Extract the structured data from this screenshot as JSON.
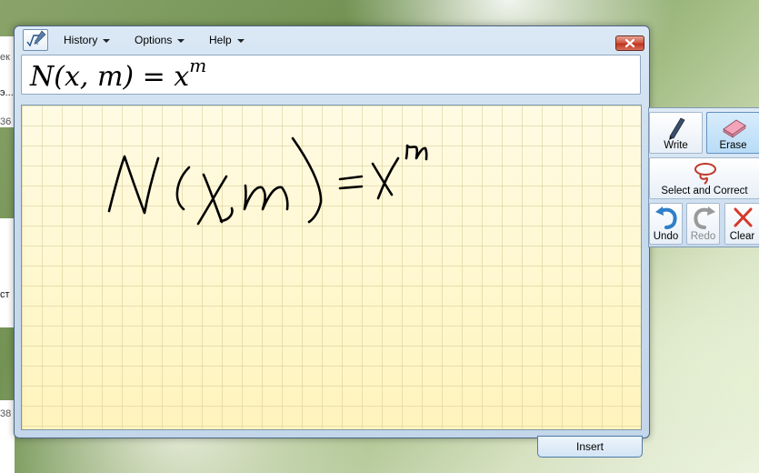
{
  "background": {
    "fragments": [
      "ек",
      "э...",
      "36",
      "ст",
      "38"
    ]
  },
  "window": {
    "menu": [
      {
        "label": "History"
      },
      {
        "label": "Options"
      },
      {
        "label": "Help"
      }
    ],
    "preview_formula": "N(x, m) = x",
    "preview_superscript": "m",
    "insert_label": "Insert"
  },
  "tools": {
    "write": "Write",
    "erase": "Erase",
    "select_correct": "Select and Correct",
    "undo": "Undo",
    "redo": "Redo",
    "clear": "Clear"
  },
  "colors": {
    "accent": "#3a78b8",
    "pad": "#fff6c4",
    "close": "#c2341e"
  },
  "icons": [
    "math-input-icon",
    "pen-icon",
    "eraser-icon",
    "lasso-icon",
    "undo-icon",
    "redo-icon",
    "clear-x-icon"
  ]
}
